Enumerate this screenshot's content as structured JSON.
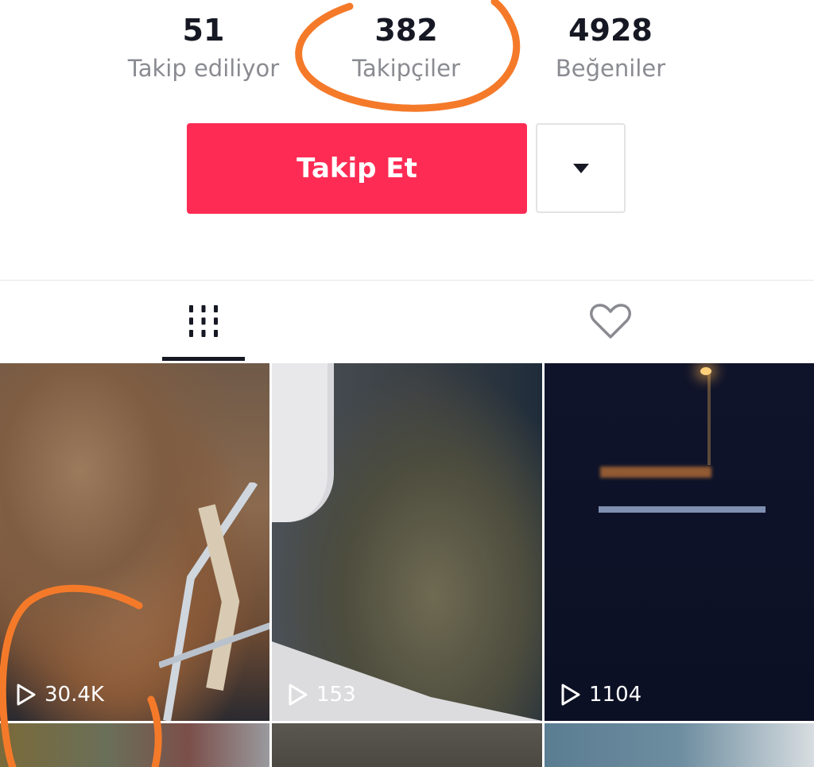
{
  "profile_stats": {
    "following": {
      "value": "51",
      "label": "Takip ediliyor"
    },
    "followers": {
      "value": "382",
      "label": "Takipçiler"
    },
    "likes": {
      "value": "4928",
      "label": "Beğeniler"
    }
  },
  "actions": {
    "follow_label": "Takip Et",
    "more_icon": "caret-down-icon"
  },
  "tabs": [
    {
      "name": "videos",
      "icon": "grid-icon",
      "selected": true
    },
    {
      "name": "liked",
      "icon": "heart-icon",
      "selected": false
    }
  ],
  "videos": [
    {
      "play_count": "30.4K"
    },
    {
      "play_count": "153"
    },
    {
      "play_count": "1104"
    },
    {
      "play_count": ""
    },
    {
      "play_count": ""
    },
    {
      "play_count": ""
    }
  ],
  "colors": {
    "accent": "#fe2c55",
    "annotation": "#f47a2a",
    "text_primary": "#161823",
    "text_secondary": "#8a8b91"
  }
}
